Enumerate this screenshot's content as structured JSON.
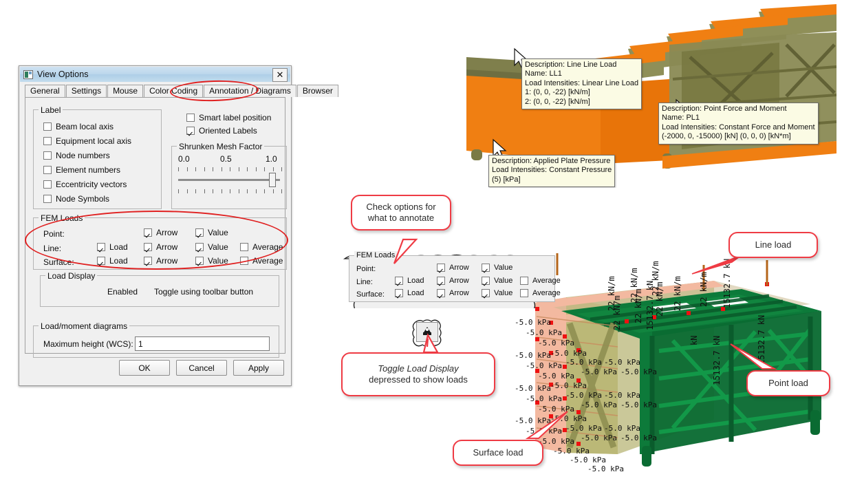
{
  "dialog": {
    "title": "View Options",
    "close_label": "✕",
    "tabs": [
      {
        "label": "General",
        "selected": false
      },
      {
        "label": "Settings",
        "selected": false
      },
      {
        "label": "Mouse",
        "selected": false
      },
      {
        "label": "Color Coding",
        "selected": false
      },
      {
        "label": "Annotation / Diagrams",
        "selected": true
      },
      {
        "label": "Browser",
        "selected": false
      }
    ],
    "label_group": {
      "title": "Label",
      "items": [
        {
          "label": "Beam local axis",
          "checked": false
        },
        {
          "label": "Equipment local axis",
          "checked": false
        },
        {
          "label": "Node numbers",
          "checked": false
        },
        {
          "label": "Element numbers",
          "checked": false
        },
        {
          "label": "Eccentricity vectors",
          "checked": false
        },
        {
          "label": "Node Symbols",
          "checked": false
        }
      ]
    },
    "right_options": [
      {
        "label": "Smart label position",
        "checked": false
      },
      {
        "label": "Oriented Labels",
        "checked": true
      }
    ],
    "shrunken_mesh": {
      "title": "Shrunken Mesh Factor",
      "min_label": "0.0",
      "mid_label": "0.5",
      "max_label": "1.0",
      "value": 1.0
    },
    "fem_loads": {
      "title": "FEM Loads",
      "rows": [
        {
          "name": "Point:",
          "load": null,
          "arrow": {
            "label": "Arrow",
            "checked": true
          },
          "value": {
            "label": "Value",
            "checked": true
          },
          "average": null
        },
        {
          "name": "Line:",
          "load": {
            "label": "Load",
            "checked": true
          },
          "arrow": {
            "label": "Arrow",
            "checked": true
          },
          "value": {
            "label": "Value",
            "checked": true
          },
          "average": {
            "label": "Average",
            "checked": false
          }
        },
        {
          "name": "Surface:",
          "load": {
            "label": "Load",
            "checked": true
          },
          "arrow": {
            "label": "Arrow",
            "checked": true
          },
          "value": {
            "label": "Value",
            "checked": true
          },
          "average": {
            "label": "Average",
            "checked": false
          }
        }
      ]
    },
    "load_display": {
      "title": "Load Display",
      "state": "Enabled",
      "hint": "Toggle using toolbar button"
    },
    "load_moment": {
      "title": "Load/moment diagrams",
      "field_label": "Maximum height (WCS):",
      "field_value": "1"
    },
    "buttons": {
      "ok": "OK",
      "cancel": "Cancel",
      "apply": "Apply"
    }
  },
  "tooltips": {
    "line_load": {
      "lines": [
        "Description: Line Line Load",
        "Name: LL1",
        "Load Intensities: Linear Line Load",
        "1: (0, 0, -22) [kN/m]",
        "2: (0, 0, -22) [kN/m]"
      ]
    },
    "point_load": {
      "lines": [
        "Description: Point Force and Moment",
        "Name: PL1",
        "Load Intensities: Constant Force and Moment",
        "(-2000, 0, -15000) [kN] (0, 0, 0) [kN*m]"
      ]
    },
    "plate_pressure": {
      "lines": [
        "Description: Applied Plate Pressure",
        "Load Intensities: Constant Pressure",
        "(5) [kPa]"
      ]
    }
  },
  "callouts": {
    "annotate": "Check options for\nwhat to annotate",
    "toggle_italic": "Toggle Load Display",
    "toggle_rest": "depressed to show loads",
    "line_load": "Line load",
    "point_load": "Point load",
    "surface_load": "Surface load"
  },
  "model_labels": {
    "line_value": "22 kN/m",
    "point_value": "15132.7 kN",
    "surface_value": "-5.0 kPa",
    "kn_short": "kN"
  },
  "colors": {
    "accent_red": "#ef3b44",
    "highlight_red": "#e02020",
    "orange_plate": "#f07f12",
    "olive_beam": "#8b8b52",
    "frame_green": "#0d7a3a",
    "dark_green": "#0a5c2c",
    "surface_pink": "#f3b9a0",
    "tooltip_bg": "#fbfbe4",
    "titlebar_blue": "#bcd7ec",
    "node_red": "#ee1111"
  }
}
